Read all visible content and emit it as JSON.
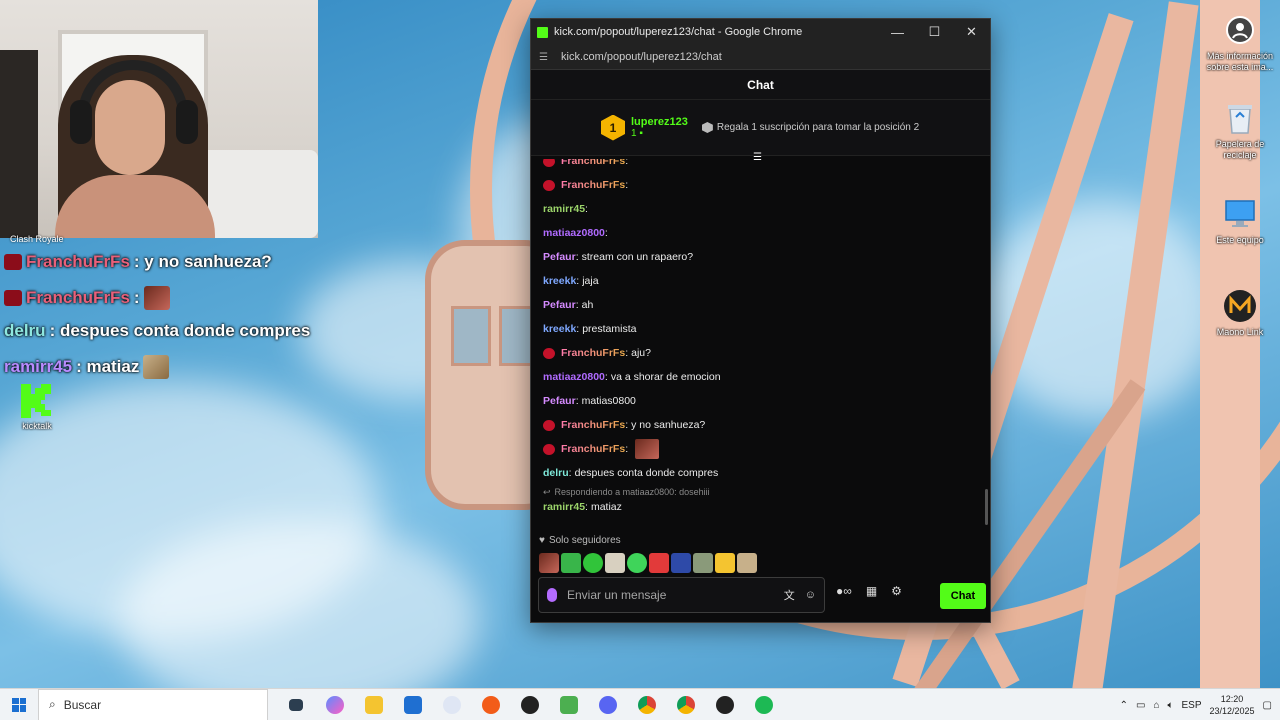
{
  "webcam": {
    "caption": "Clash Royale"
  },
  "overlay_chat": [
    {
      "user": "FranchuFrFs",
      "text": ": y no sanhueza?",
      "has_badge": true,
      "emote": false
    },
    {
      "user": "FranchuFrFs",
      "text": ":",
      "has_badge": true,
      "emote": true
    },
    {
      "user": "delru",
      "text": ": despues conta donde compres",
      "has_badge": false,
      "emote": false
    },
    {
      "user": "ramirr45",
      "text": ": matiaz",
      "has_badge": false,
      "emote": true
    }
  ],
  "desktop_icons": {
    "kicktalk": "kicktalk",
    "info": "Más información sobre esta ima...",
    "recycle": "Papelera de reciclaje",
    "pc": "Este equipo",
    "maono": "Maono Link"
  },
  "browser": {
    "window_title": "kick.com/popout/luperez123/chat - Google Chrome",
    "url": "kick.com/popout/luperez123/chat",
    "minimize": "—",
    "maximize": "☐",
    "close": "✕"
  },
  "chat": {
    "header": "Chat",
    "leaderboard": {
      "rank": "1",
      "name": "luperez123",
      "count": "1",
      "gift_text": "Regala 1 suscripción para tomar la posición 2"
    },
    "messages": [
      {
        "user": "FranchuFrFs",
        "text": "",
        "badge": true,
        "color": "pink"
      },
      {
        "user": "FranchuFrFs",
        "text": "",
        "badge": true,
        "color": "pink"
      },
      {
        "user": "ramirr45",
        "text": "",
        "badge": false,
        "color": "green"
      },
      {
        "user": "matiaaz0800",
        "text": "",
        "badge": false,
        "color": "purple"
      },
      {
        "user": "Pefaur",
        "text": "stream con un rapaero?",
        "badge": false,
        "color": "violet"
      },
      {
        "user": "kreekk",
        "text": "jaja",
        "badge": false,
        "color": "blue"
      },
      {
        "user": "Pefaur",
        "text": "ah",
        "badge": false,
        "color": "violet"
      },
      {
        "user": "kreekk",
        "text": "prestamista",
        "badge": false,
        "color": "blue"
      },
      {
        "user": "FranchuFrFs",
        "text": "aju?",
        "badge": true,
        "color": "pink"
      },
      {
        "user": "matiaaz0800",
        "text": "va a shorar de emocion",
        "badge": false,
        "color": "purple"
      },
      {
        "user": "Pefaur",
        "text": "matias0800",
        "badge": false,
        "color": "violet"
      },
      {
        "user": "FranchuFrFs",
        "text": "y no sanhueza?",
        "badge": true,
        "color": "pink"
      },
      {
        "user": "FranchuFrFs",
        "text": "",
        "badge": true,
        "color": "pink",
        "emote": true
      },
      {
        "user": "delru",
        "text": "despues conta donde compres",
        "badge": false,
        "color": "cyan"
      }
    ],
    "reply": {
      "context": "Respondiendo a matiaaz0800: dosehiii",
      "user": "ramirr45",
      "text": "matiaz"
    },
    "followers_only": "Solo seguidores",
    "input_placeholder": "Enviar un mensaje",
    "send_label": "Chat"
  },
  "taskbar": {
    "search_placeholder": "Buscar",
    "language": "ESP",
    "time": "12:20",
    "date": "23/12/2025"
  },
  "colors": {
    "kick_green": "#53fc18",
    "chat_bg": "#0b0b0c"
  }
}
